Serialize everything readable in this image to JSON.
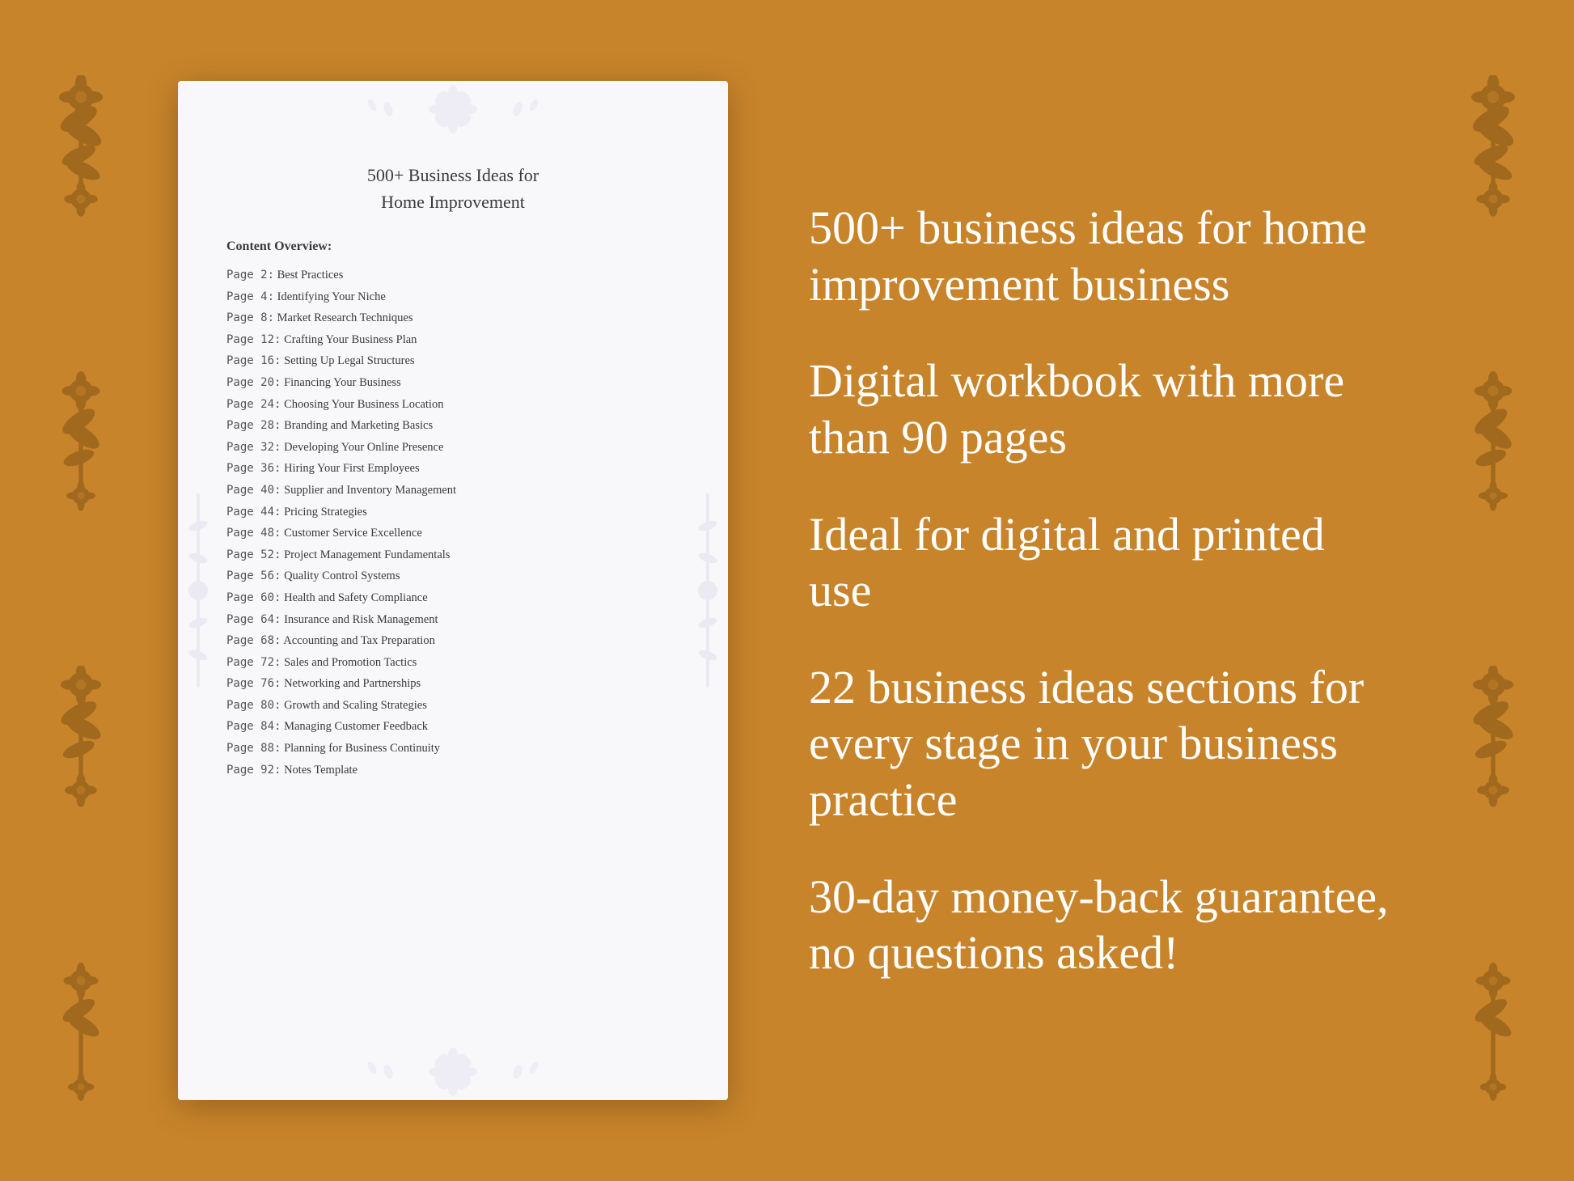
{
  "background_color": "#C8842A",
  "book": {
    "title_line1": "500+ Business Ideas for",
    "title_line2": "Home Improvement",
    "content_label": "Content Overview:",
    "toc_items": [
      {
        "page": "Page  2:",
        "topic": "Best Practices"
      },
      {
        "page": "Page  4:",
        "topic": "Identifying Your Niche"
      },
      {
        "page": "Page  8:",
        "topic": "Market Research Techniques"
      },
      {
        "page": "Page 12:",
        "topic": "Crafting Your Business Plan"
      },
      {
        "page": "Page 16:",
        "topic": "Setting Up Legal Structures"
      },
      {
        "page": "Page 20:",
        "topic": "Financing Your Business"
      },
      {
        "page": "Page 24:",
        "topic": "Choosing Your Business Location"
      },
      {
        "page": "Page 28:",
        "topic": "Branding and Marketing Basics"
      },
      {
        "page": "Page 32:",
        "topic": "Developing Your Online Presence"
      },
      {
        "page": "Page 36:",
        "topic": "Hiring Your First Employees"
      },
      {
        "page": "Page 40:",
        "topic": "Supplier and Inventory Management"
      },
      {
        "page": "Page 44:",
        "topic": "Pricing Strategies"
      },
      {
        "page": "Page 48:",
        "topic": "Customer Service Excellence"
      },
      {
        "page": "Page 52:",
        "topic": "Project Management Fundamentals"
      },
      {
        "page": "Page 56:",
        "topic": "Quality Control Systems"
      },
      {
        "page": "Page 60:",
        "topic": "Health and Safety Compliance"
      },
      {
        "page": "Page 64:",
        "topic": "Insurance and Risk Management"
      },
      {
        "page": "Page 68:",
        "topic": "Accounting and Tax Preparation"
      },
      {
        "page": "Page 72:",
        "topic": "Sales and Promotion Tactics"
      },
      {
        "page": "Page 76:",
        "topic": "Networking and Partnerships"
      },
      {
        "page": "Page 80:",
        "topic": "Growth and Scaling Strategies"
      },
      {
        "page": "Page 84:",
        "topic": "Managing Customer Feedback"
      },
      {
        "page": "Page 88:",
        "topic": "Planning for Business Continuity"
      },
      {
        "page": "Page 92:",
        "topic": "Notes Template"
      }
    ]
  },
  "features": [
    {
      "id": "feature1",
      "text": "500+ business ideas for home improvement business"
    },
    {
      "id": "feature2",
      "text": "Digital workbook with more than 90 pages"
    },
    {
      "id": "feature3",
      "text": "Ideal for digital and printed use"
    },
    {
      "id": "feature4",
      "text": "22 business ideas sections for every stage in your business practice"
    },
    {
      "id": "feature5",
      "text": "30-day money-back guarantee, no questions asked!"
    }
  ]
}
